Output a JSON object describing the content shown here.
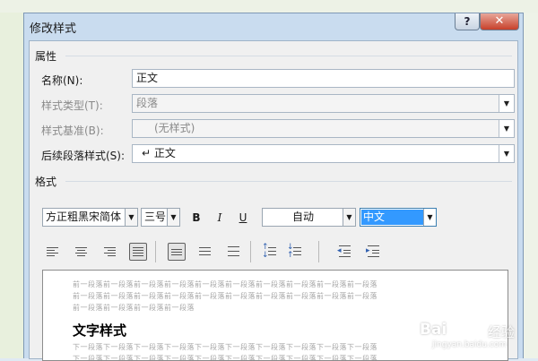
{
  "dialog": {
    "title": "修改样式",
    "help_label": "?",
    "close_label": "✕"
  },
  "properties": {
    "group_title": "属性",
    "name_label": "名称(N):",
    "name_value": "正文",
    "style_type_label": "样式类型(T):",
    "style_type_value": "段落",
    "style_based_label": "样式基准(B):",
    "style_based_value": "(无样式)",
    "next_style_label": "后续段落样式(S):",
    "next_style_value": "↵ 正文"
  },
  "format": {
    "group_title": "格式",
    "font_family": "方正粗黑宋简体",
    "font_size": "三号",
    "bold_label": "B",
    "italic_label": "I",
    "underline_label": "U",
    "color_value": "自动",
    "script_value": "中文"
  },
  "preview": {
    "prev_para_lines": [
      "前一段落前一段落前一段落前一段落前一段落前一段落前一段落前一段落前一段落前一段落",
      "前一段落前一段落前一段落前一段落前一段落前一段落前一段落前一段落前一段落前一段落",
      "前一段落前一段落前一段落前一段落"
    ],
    "sample_text": "文字样式",
    "next_para_lines": [
      "下一段落下一段落下一段落下一段落下一段落下一段落下一段落下一段落下一段落下一段落",
      "下一段落下一段落下一段落下一段落下一段落下一段落下一段落下一段落下一段落下一段落"
    ]
  },
  "watermark": {
    "brand": "Bai",
    "suffix": "经验",
    "url": "jingyan.baidu.com"
  },
  "icons": [
    "help-icon",
    "close-icon",
    "align-left-icon",
    "align-center-icon",
    "align-right-icon",
    "justify-icon",
    "single-spacing-icon",
    "one-half-spacing-icon",
    "double-spacing-icon",
    "increase-paragraph-spacing-icon",
    "decrease-paragraph-spacing-icon",
    "decrease-indent-icon",
    "increase-indent-icon",
    "chevron-down-icon"
  ]
}
